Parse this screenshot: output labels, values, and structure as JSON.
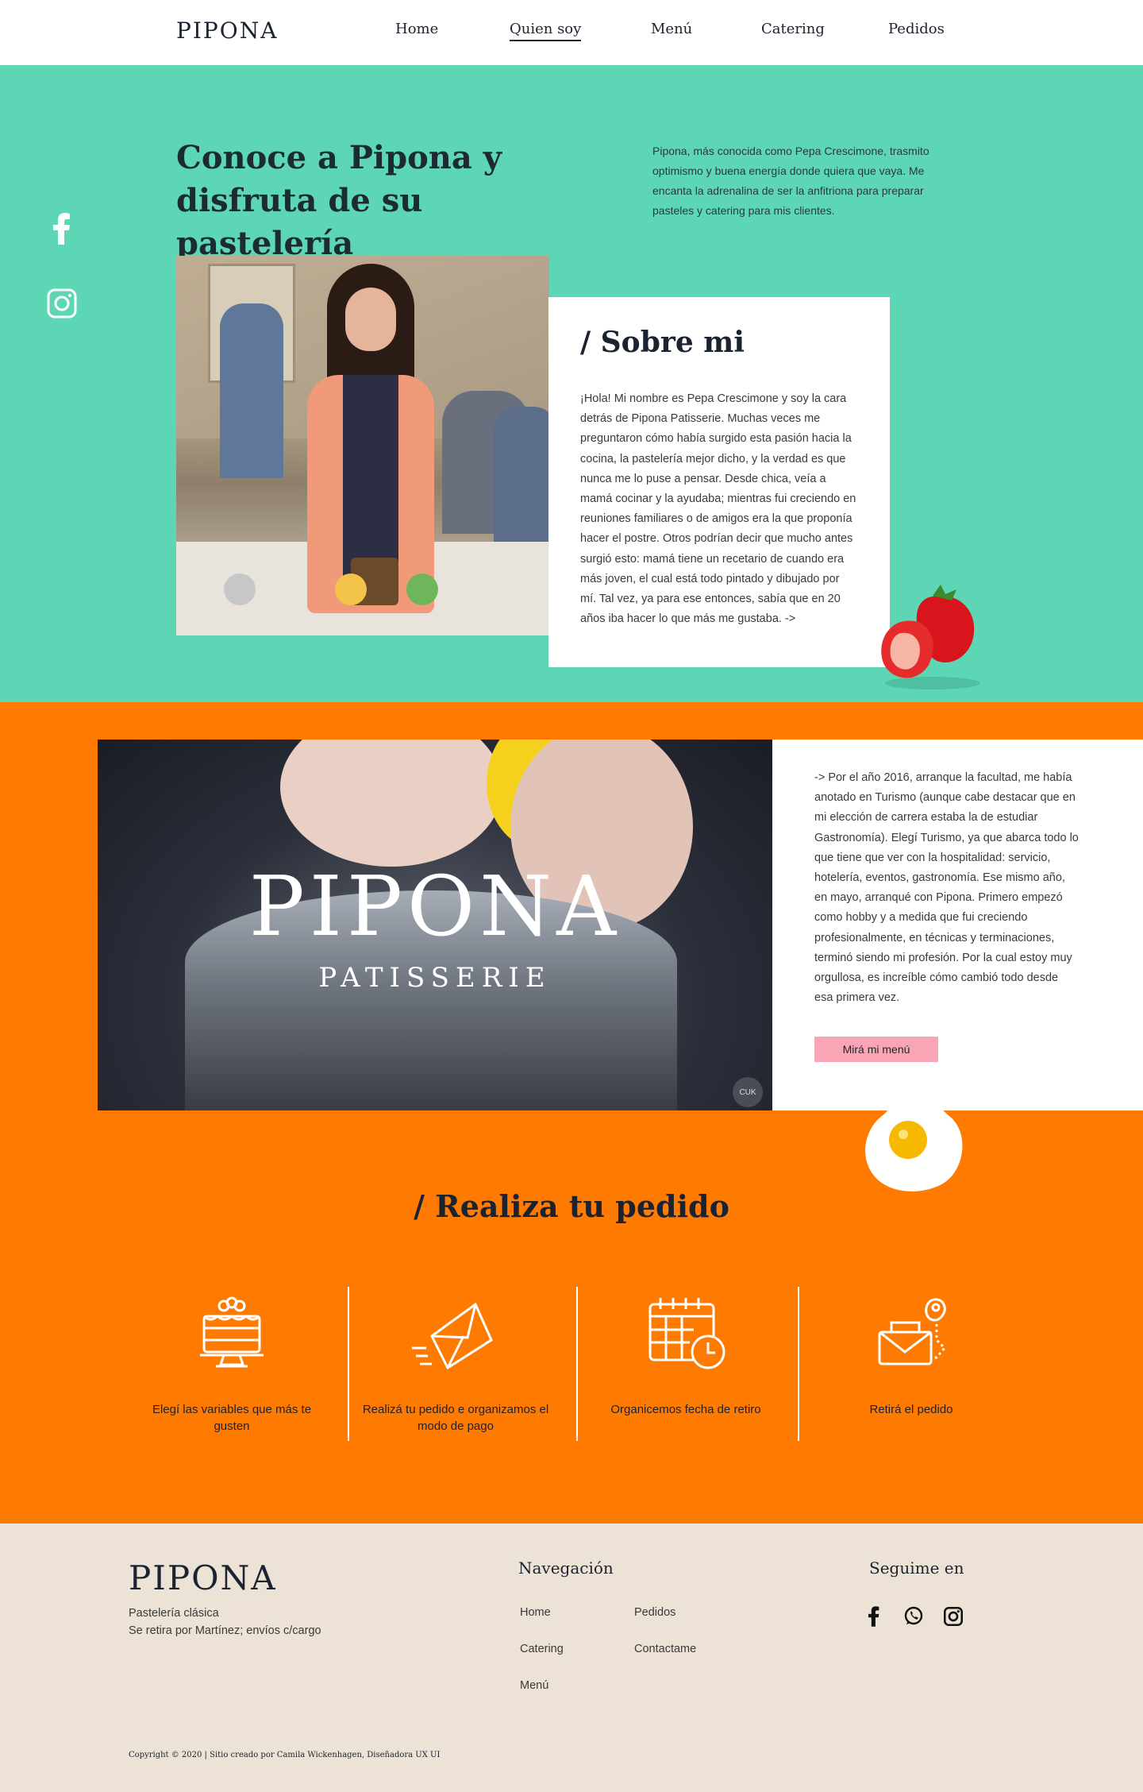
{
  "nav": {
    "logo": "PIPONA",
    "links": [
      "Home",
      "Quien soy",
      "Menú",
      "Catering",
      "Pedidos"
    ],
    "active": "Quien soy"
  },
  "hero": {
    "title": "Conoce a Pipona y disfruta de su pastelería",
    "intro": "Pipona, más conocida como Pepa Crescimone, trasmito optimismo y buena energía donde quiera que vaya.  Me encanta la adrenalina de ser la anfitriona para preparar pasteles y catering para mis clientes.",
    "social_icons": [
      "facebook-icon",
      "instagram-icon"
    ]
  },
  "about": {
    "heading": "/ Sobre mi",
    "body": "¡Hola! Mi nombre es Pepa Crescimone y soy la cara detrás de Pipona Patisserie. Muchas veces me preguntaron cómo había surgido esta pasión hacia la cocina, la pastelería mejor dicho, y la verdad es que nunca me lo puse a pensar. Desde chica, veía a mamá cocinar y la ayudaba; mientras fui creciendo en reuniones familiares o de amigos era la que proponía hacer el postre. Otros podrían decir que mucho antes surgió esto: mamá tiene un recetario de cuando era más joven, el cual está todo pintado y dibujado por mí. Tal vez, ya para ese entonces, sabía que en 20 años iba hacer lo que más me gustaba.  ->"
  },
  "video": {
    "logo": "PIPONA",
    "sub": "PATISSERIE",
    "badge": "CUK"
  },
  "story": {
    "body": "-> Por el año 2016, arranque la facultad, me había anotado en Turismo (aunque cabe destacar que en mi elección de carrera estaba la de estudiar Gastronomía). Elegí Turismo, ya que abarca todo lo que tiene que ver con la hospitalidad: servicio, hotelería, eventos, gastronomía.  Ese mismo año, en mayo, arranqué con Pipona. Primero empezó como hobby y a medida que fui creciendo profesionalmente, en técnicas y terminaciones, terminó siendo mi profesión. Por la cual estoy muy orgullosa, es increíble cómo cambió todo desde esa primera vez.",
    "button": "Mirá mi menú"
  },
  "order": {
    "title": "/ Realiza tu pedido",
    "steps": [
      {
        "icon": "cake-icon",
        "label": "Elegí las variables que más te gusten"
      },
      {
        "icon": "envelope-icon",
        "label": "Realizá tu pedido e organizamos el modo de pago"
      },
      {
        "icon": "calendar-icon",
        "label": "Organicemos fecha de retiro"
      },
      {
        "icon": "delivery-icon",
        "label": "Retirá el pedido"
      }
    ]
  },
  "footer": {
    "logo": "PIPONA",
    "tagline": "Pastelería clásica",
    "pickup": "Se retira por Martínez; envíos c/cargo",
    "nav_heading": "Navegación",
    "nav_links": [
      "Home",
      "Catering",
      "Menú",
      "Pedidos",
      "Contactame"
    ],
    "social_heading": "Seguime en",
    "social_icons": [
      "facebook-icon",
      "whatsapp-icon",
      "instagram-icon"
    ],
    "copyright": "Copyright © 2020 | Sitio creado por Camila Wickenhagen, Diseñadora UX UI"
  },
  "colors": {
    "mint": "#5dd6b6",
    "orange": "#ff7a00",
    "pink_button": "#f8a5b5",
    "footer_bg": "#ece2d6",
    "text_dark": "#1b2230"
  }
}
